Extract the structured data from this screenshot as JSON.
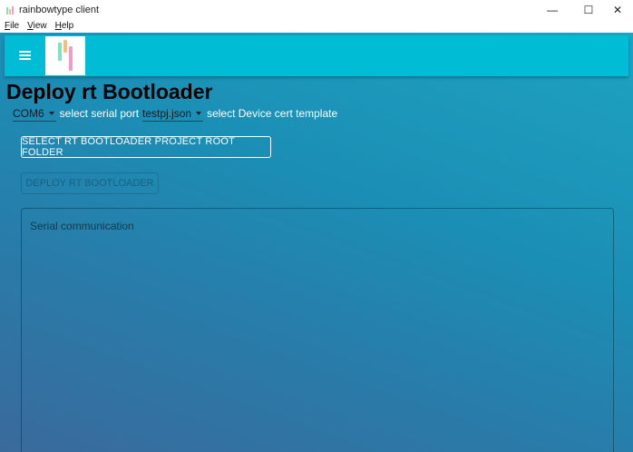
{
  "window": {
    "title": "rainbowtype client",
    "controls": {
      "minimize": "—",
      "maximize": "☐",
      "close": "✕"
    }
  },
  "menubar": {
    "items": [
      "File",
      "View",
      "Help"
    ]
  },
  "page": {
    "title": "Deploy rt Bootloader",
    "serial_port": {
      "value": "COM6",
      "hint": "select serial port"
    },
    "cert_template": {
      "value": "testpj.json",
      "hint": "select Device cert template"
    },
    "select_folder_button": "SELECT RT BOOTLOADER PROJECT ROOT FOLDER",
    "deploy_button": "DEPLOY RT BOOTLOADER",
    "serial_box_label": "Serial communication"
  },
  "colors": {
    "appbar": "#00bcd4",
    "logo_bars": [
      "#7de3c5",
      "#f3c07a",
      "#f39ac7"
    ]
  }
}
